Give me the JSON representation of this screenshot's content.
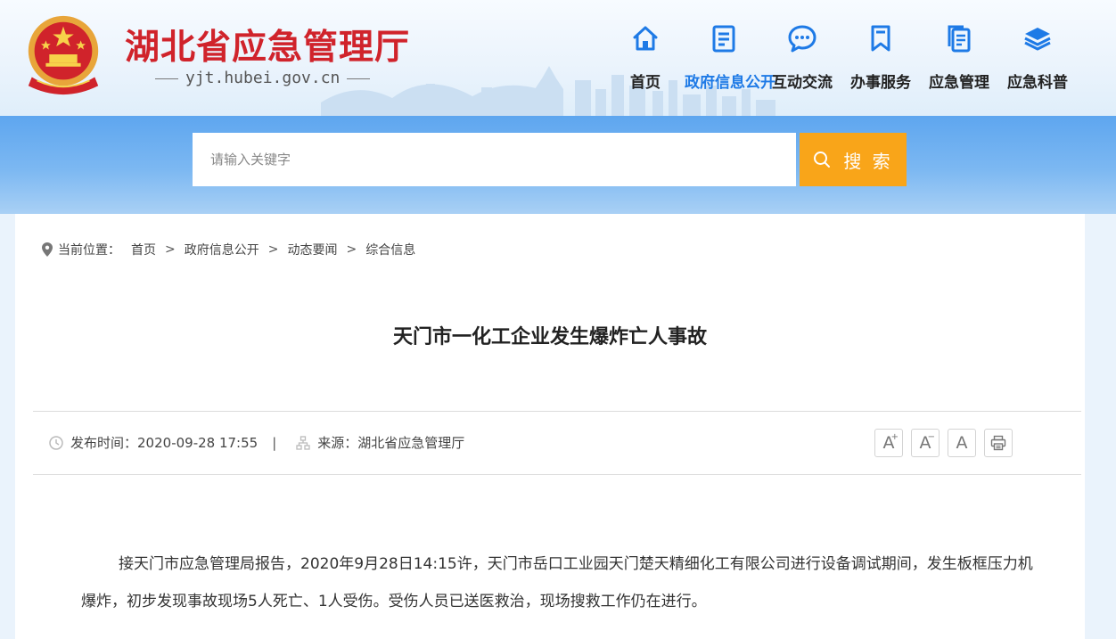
{
  "site": {
    "title": "湖北省应急管理厅",
    "domain": "yjt.hubei.gov.cn"
  },
  "nav": [
    {
      "label": "首页",
      "icon": "home-icon"
    },
    {
      "label": "政府信息公开",
      "icon": "document-list-icon",
      "active": true
    },
    {
      "label": "互动交流",
      "icon": "chat-bubble-icon"
    },
    {
      "label": "办事服务",
      "icon": "bookmark-icon"
    },
    {
      "label": "应急管理",
      "icon": "copy-document-icon"
    },
    {
      "label": "应急科普",
      "icon": "layers-icon"
    }
  ],
  "search": {
    "placeholder": "请输入关键字",
    "button_label": "搜 索"
  },
  "breadcrumb": {
    "prefix": "当前位置：",
    "items": [
      "首页",
      "政府信息公开",
      "动态要闻",
      "综合信息"
    ]
  },
  "article": {
    "title": "天门市一化工企业发生爆炸亡人事故",
    "publish_label": "发布时间：",
    "publish_time": "2020-09-28 17:55",
    "source_label": "来源：",
    "source": "湖北省应急管理厅",
    "body": "接天门市应急管理局报告，2020年9月28日14:15许，天门市岳口工业园天门楚天精细化工有限公司进行设备调试期间，发生板框压力机爆炸，初步发现事故现场5人死亡、1人受伤。受伤人员已送医救治，现场搜救工作仍在进行。"
  },
  "tools": {
    "font_larger": "A",
    "font_smaller": "A",
    "font_default": "A"
  },
  "colors": {
    "title_red": "#d0232b",
    "nav_active": "#1e7ae6",
    "search_button": "#f9a519",
    "band_blue": "#5ea6ef"
  }
}
